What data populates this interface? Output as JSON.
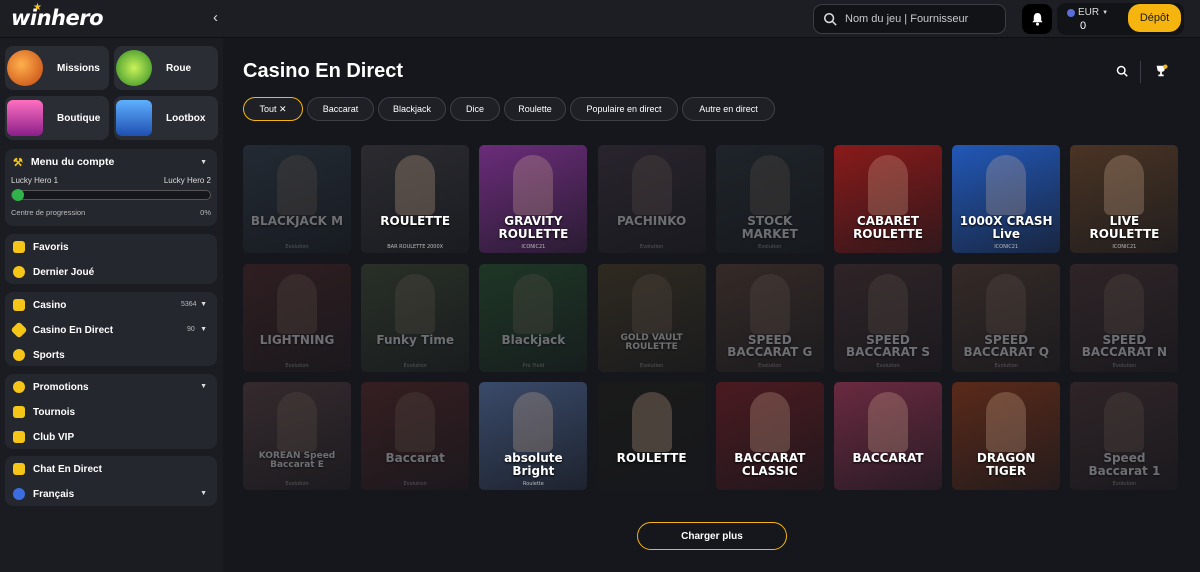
{
  "header": {
    "logo": "winhero",
    "search_placeholder": "Nom du jeu | Fournisseur",
    "currency": "EUR",
    "balance": "0",
    "deposit_label": "Dépôt"
  },
  "sidebar": {
    "tiles": [
      {
        "label": "Missions",
        "color": "#e8731f"
      },
      {
        "label": "Roue",
        "color": "#4fbf3a"
      },
      {
        "label": "Boutique",
        "color": "#d64fa3"
      },
      {
        "label": "Lootbox",
        "color": "#2f7fd8"
      }
    ],
    "account": {
      "menu_label": "Menu du compte",
      "level_from": "Lucky Hero 1",
      "level_to": "Lucky Hero 2",
      "progress_label": "Centre de progression",
      "progress_value": "0%"
    },
    "group1": [
      "Favoris",
      "Dernier Joué"
    ],
    "group2": [
      {
        "label": "Casino",
        "count": "5364"
      },
      {
        "label": "Casino En Direct",
        "count": "90"
      },
      {
        "label": "Sports",
        "count": ""
      }
    ],
    "group3": [
      "Promotions",
      "Tournois",
      "Club VIP"
    ],
    "group4": [
      "Chat En Direct",
      "Français"
    ]
  },
  "main": {
    "title": "Casino En Direct",
    "filters": [
      "Tout ✕",
      "Baccarat",
      "Blackjack",
      "Dice",
      "Roulette",
      "Populaire en direct",
      "Autre en direct"
    ],
    "load_more": "Charger plus"
  },
  "games": [
    {
      "name": "BLACKJACK M",
      "provider": "Evolution",
      "bg": "#3a4a5a",
      "dim": true
    },
    {
      "name": "ROULETTE",
      "provider": "BAR ROULETTE 2000X",
      "bg": "#2b2b30",
      "dim": false
    },
    {
      "name": "GRAVITY ROULETTE",
      "provider": "ICONIC21",
      "bg": "#6b2c7a",
      "dim": false
    },
    {
      "name": "PACHINKO",
      "provider": "Evolution",
      "bg": "#4b3a4a",
      "dim": true
    },
    {
      "name": "STOCK MARKET",
      "provider": "Evolution",
      "bg": "#2e3a40",
      "dim": true
    },
    {
      "name": "CABARET ROULETTE",
      "provider": "",
      "bg": "#8a1a1a",
      "dim": false
    },
    {
      "name": "1000X CRASH Live",
      "provider": "ICONIC21",
      "bg": "#2258b8",
      "dim": false
    },
    {
      "name": "LIVE ROULETTE",
      "provider": "ICONIC21",
      "bg": "#4a3424",
      "dim": false
    },
    {
      "name": "LIGHTNING",
      "provider": "Evolution",
      "bg": "#5a2a2a",
      "dim": true
    },
    {
      "name": "Funky Time",
      "provider": "Evolution",
      "bg": "#4a5a3a",
      "dim": true
    },
    {
      "name": "Blackjack",
      "provider": "Pro Yield",
      "bg": "#2f6a35",
      "dim": true
    },
    {
      "name": "GOLD VAULT ROULETTE",
      "provider": "Evolution",
      "bg": "#5a4a2a",
      "dim": true
    },
    {
      "name": "SPEED BACCARAT G",
      "provider": "Evolution",
      "bg": "#6a4a3a",
      "dim": true
    },
    {
      "name": "SPEED BACCARAT S",
      "provider": "Evolution",
      "bg": "#5a3a3a",
      "dim": true
    },
    {
      "name": "SPEED BACCARAT Q",
      "provider": "Evolution",
      "bg": "#6a4a3a",
      "dim": true
    },
    {
      "name": "SPEED BACCARAT N",
      "provider": "Evolution",
      "bg": "#5a3a3a",
      "dim": true
    },
    {
      "name": "KOREAN Speed Baccarat E",
      "provider": "Evolution",
      "bg": "#6a4a4a",
      "dim": true
    },
    {
      "name": "Baccarat",
      "provider": "Evolution",
      "bg": "#6a2a2a",
      "dim": true
    },
    {
      "name": "absolute Bright",
      "provider": "Roulette",
      "bg": "#3a4a6a",
      "dim": false
    },
    {
      "name": "ROULETTE",
      "provider": "",
      "bg": "#1a1a1a",
      "dim": false
    },
    {
      "name": "BACCARAT CLASSIC",
      "provider": "",
      "bg": "#4a1a20",
      "dim": false
    },
    {
      "name": "BACCARAT",
      "provider": "",
      "bg": "#6a2a40",
      "dim": false
    },
    {
      "name": "DRAGON TIGER",
      "provider": "",
      "bg": "#5a2a1a",
      "dim": false
    },
    {
      "name": "Speed Baccarat 1",
      "provider": "Evolution",
      "bg": "#5a3a3a",
      "dim": true
    }
  ]
}
